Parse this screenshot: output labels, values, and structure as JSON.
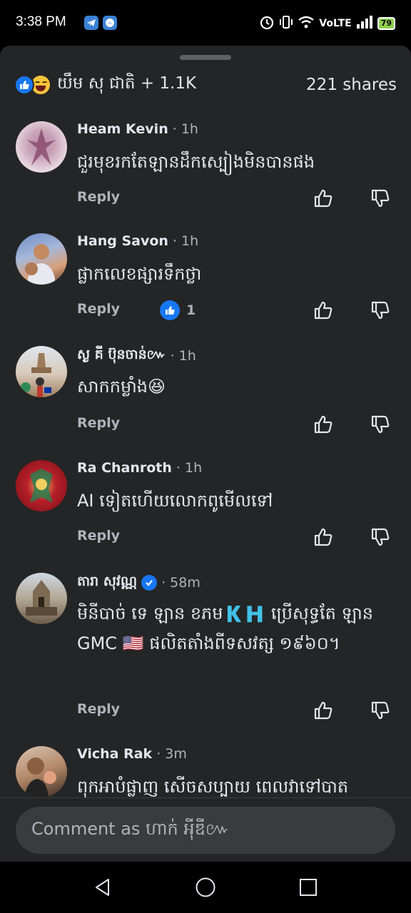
{
  "status_bar": {
    "time": "3:38 PM",
    "network": "VoLTE",
    "battery": "79"
  },
  "post": {
    "reactions_text": "យឹម សុ ជាតិ + 1.1K",
    "shares_text": "221 shares"
  },
  "comments": [
    {
      "name": "Heam Kevin",
      "time": "· 1h",
      "text": "ជួរមុខរកតែឡានដឹកស្បៀងមិនបានផង",
      "reply": "Reply",
      "like_count": ""
    },
    {
      "name": "Hang Savon",
      "time": "· 1h",
      "text": "ផ្លាកលេខផ្សារទឹកថ្លា",
      "reply": "Reply",
      "like_count": "1"
    },
    {
      "name": "ស្ង គី ប៊ុនចាន់៚",
      "time": "· 1h",
      "text": "សាកកម្លាំង😆",
      "reply": "Reply",
      "like_count": ""
    },
    {
      "name": "Ra Chanroth",
      "time": "· 1h",
      "text": "AI ទៀតហើយលោកពូមើលទៅ",
      "reply": "Reply",
      "like_count": ""
    },
    {
      "name": "តារា សុវណ្ណ",
      "time": "· 58m",
      "verified": true,
      "text": "មិនីបាច់ ទេ ឡាន ខភម🇰🇭 ប្រើសុទ្ធតែ ឡាន GMC 🇺🇸 ផលិតតាំងពីទសវត្ស ១៩៦០។",
      "reply": "Reply",
      "like_count": ""
    },
    {
      "name": "Vicha Rak",
      "time": "· 3m",
      "text": "ពុកអាបំផ្លាញ សើចសប្បាយ ពេលវាទៅបាត",
      "reply": "",
      "like_count": ""
    }
  ],
  "composer": {
    "placeholder": "Comment as ហាក់ អុីឌី៚"
  },
  "colors": {
    "background": "#242526",
    "accent": "#1877f2",
    "secondary_text": "#b0b3b8"
  },
  "icons": [
    "like-icon",
    "haha-icon",
    "thumb-up-icon",
    "thumb-down-icon",
    "verified-icon",
    "back-icon",
    "home-icon",
    "recents-icon"
  ]
}
